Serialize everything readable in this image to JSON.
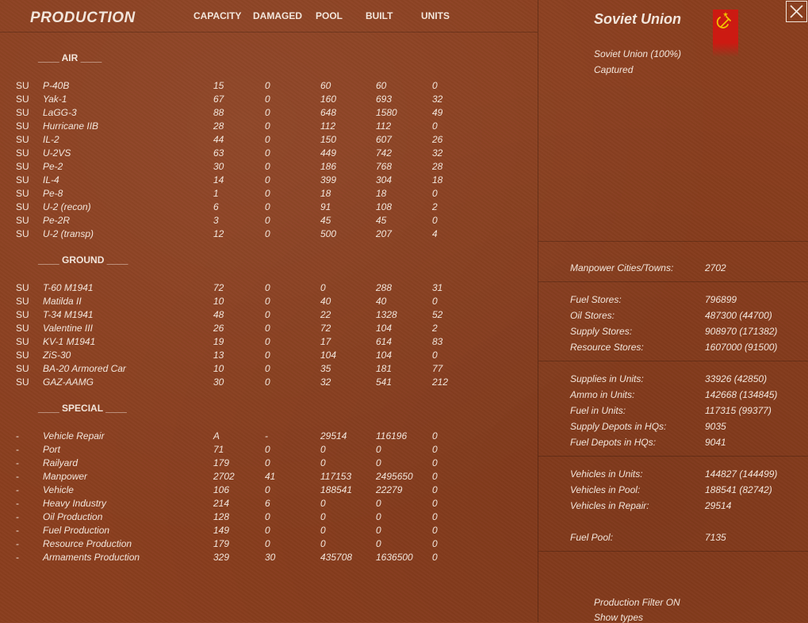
{
  "header": {
    "title": "PRODUCTION",
    "columns": [
      "CAPACITY",
      "DAMAGED",
      "POOL",
      "BUILT",
      "UNITS"
    ]
  },
  "sections": [
    {
      "label": "____  AIR  ____",
      "rows": [
        [
          "SU",
          "P-40B",
          "15",
          "0",
          "60",
          "60",
          "0"
        ],
        [
          "SU",
          "Yak-1",
          "67",
          "0",
          "160",
          "693",
          "32"
        ],
        [
          "SU",
          "LaGG-3",
          "88",
          "0",
          "648",
          "1580",
          "49"
        ],
        [
          "SU",
          "Hurricane IIB",
          "28",
          "0",
          "112",
          "112",
          "0"
        ],
        [
          "SU",
          "IL-2",
          "44",
          "0",
          "150",
          "607",
          "26"
        ],
        [
          "SU",
          "U-2VS",
          "63",
          "0",
          "449",
          "742",
          "32"
        ],
        [
          "SU",
          "Pe-2",
          "30",
          "0",
          "186",
          "768",
          "28"
        ],
        [
          "SU",
          "IL-4",
          "14",
          "0",
          "399",
          "304",
          "18"
        ],
        [
          "SU",
          "Pe-8",
          "1",
          "0",
          "18",
          "18",
          "0"
        ],
        [
          "SU",
          "U-2 (recon)",
          "6",
          "0",
          "91",
          "108",
          "2"
        ],
        [
          "SU",
          "Pe-2R",
          "3",
          "0",
          "45",
          "45",
          "0"
        ],
        [
          "SU",
          "U-2 (transp)",
          "12",
          "0",
          "500",
          "207",
          "4"
        ]
      ]
    },
    {
      "label": "____ GROUND ____",
      "rows": [
        [
          "SU",
          "T-60 M1941",
          "72",
          "0",
          "0",
          "288",
          "31"
        ],
        [
          "SU",
          "Matilda II",
          "10",
          "0",
          "40",
          "40",
          "0"
        ],
        [
          "SU",
          "T-34 M1941",
          "48",
          "0",
          "22",
          "1328",
          "52"
        ],
        [
          "SU",
          "Valentine III",
          "26",
          "0",
          "72",
          "104",
          "2"
        ],
        [
          "SU",
          "KV-1 M1941",
          "19",
          "0",
          "17",
          "614",
          "83"
        ],
        [
          "SU",
          "ZiS-30",
          "13",
          "0",
          "104",
          "104",
          "0"
        ],
        [
          "SU",
          "BA-20 Armored Car",
          "10",
          "0",
          "35",
          "181",
          "77"
        ],
        [
          "SU",
          "GAZ-AAMG",
          "30",
          "0",
          "32",
          "541",
          "212"
        ]
      ]
    },
    {
      "label": "____ SPECIAL ____",
      "rows": [
        [
          "-",
          "Vehicle Repair",
          "A",
          "-",
          "29514",
          "116196",
          "0"
        ],
        [
          "-",
          "Port",
          "71",
          "0",
          "0",
          "0",
          "0"
        ],
        [
          "-",
          "Railyard",
          "179",
          "0",
          "0",
          "0",
          "0"
        ],
        [
          "-",
          "Manpower",
          "2702",
          "41",
          "117153",
          "2495650",
          "0"
        ],
        [
          "-",
          "Vehicle",
          "106",
          "0",
          "188541",
          "22279",
          "0"
        ],
        [
          "-",
          "Heavy Industry",
          "214",
          "6",
          "0",
          "0",
          "0"
        ],
        [
          "-",
          "Oil Production",
          "128",
          "0",
          "0",
          "0",
          "0"
        ],
        [
          "-",
          "Fuel Production",
          "149",
          "0",
          "0",
          "0",
          "0"
        ],
        [
          "-",
          "Resource Production",
          "179",
          "0",
          "0",
          "0",
          "0"
        ],
        [
          "-",
          "Armaments Production",
          "329",
          "30",
          "435708",
          "1636500",
          "0"
        ]
      ]
    }
  ],
  "nation": {
    "name": "Soviet Union",
    "control": "Soviet Union  (100%)",
    "status": "Captured",
    "flag_color": "#cc1a12",
    "emblem_color": "#f2c200",
    "emblem_icon": "hammer-sickle-icon"
  },
  "stat_groups": [
    [
      [
        "Manpower Cities/Towns:",
        "2702"
      ]
    ],
    [
      [
        "Fuel Stores:",
        "796899"
      ],
      [
        "Oil Stores:",
        "487300 (44700)"
      ],
      [
        "Supply Stores:",
        "908970 (171382)"
      ],
      [
        "Resource Stores:",
        "1607000 (91500)"
      ]
    ],
    [
      [
        "Supplies in Units:",
        "33926 (42850)"
      ],
      [
        "Ammo in Units:",
        "142668 (134845)"
      ],
      [
        "Fuel in Units:",
        "117315 (99377)"
      ],
      [
        "Supply Depots in HQs:",
        "9035"
      ],
      [
        "Fuel Depots in HQs:",
        "9041"
      ]
    ],
    [
      [
        "Vehicles in Units:",
        "144827 (144499)"
      ],
      [
        "Vehicles in Pool:",
        "188541 (82742)"
      ],
      [
        "Vehicles in Repair:",
        "29514"
      ],
      [
        "Fuel Pool:",
        "7135"
      ]
    ]
  ],
  "footer": {
    "filter": "Production Filter ON",
    "show_types": "Show types"
  }
}
